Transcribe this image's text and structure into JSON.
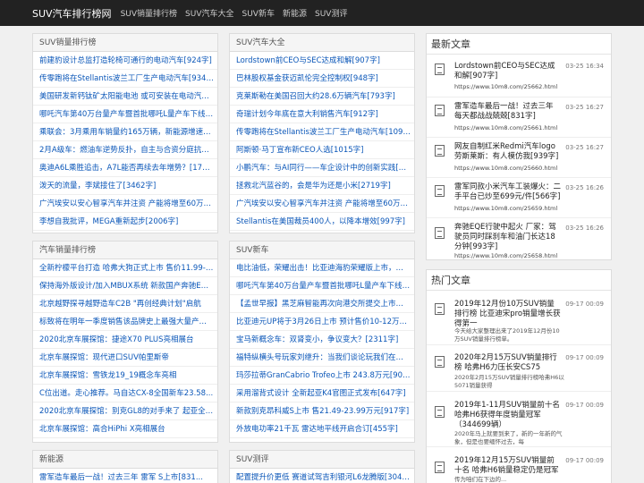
{
  "header": {
    "brand": "SUV汽车排行榜网",
    "nav": [
      "SUV销量排行榜",
      "SUV汽车大全",
      "SUV新车",
      "新能源",
      "SUV测评"
    ]
  },
  "panels": {
    "sales_rank": {
      "title": "SUV销量排行榜",
      "items": [
        "前建豹设计总监打造轮椅可通行的电动汽车[924字]",
        "传零跑将在Stellantis波兰工厂生产电动汽车[934字]",
        "美国研发新钙钛矿太阳能电池 或可安装在电动汽车上",
        "哪吒汽车第40万台量产车暨首批哪吒L量产车下线[8...",
        "乘联会：3月乘用车销量约165万辆，新能源增速37...",
        "2月A级车：燃油车逆势反扑，自主与合资分庭抗礼[...",
        "奥迪A6L乘胜追击，A7L能否再续去年增势？[1788...",
        "泼天的流量，李斌接住了[3462字]",
        "广汽埃安以安心智享汽车并注资 产能将增至60万辆...",
        "李想自我批评，MEGA重新起步[2006字]"
      ]
    },
    "suv_all": {
      "title": "SUV汽车大全",
      "items": [
        "Lordstown前CEO与SEC达成和解[907字]",
        "巴林股权基金获迈凯伦完全控制权[948字]",
        "克莱斯勒在美国召回大约28.6万辆汽车[793字]",
        "奇瑞计划今年底在意大利销售汽车[912字]",
        "传零跑将在Stellantis波兰工厂生产电动汽车[1090...",
        "阿斯顿·马丁宣布新CEO人选[1015字]",
        "小鹏汽车：与AI同行——车企设计中的创新实践[39...",
        "拯救北汽蓝谷的，会是华为还是小米[2719字]",
        "广汽埃安以安心智享汽车并注资 产能将增至60万辆...",
        "Stellantis在美国裁员400人，以降本增效[997字]"
      ]
    },
    "car_rank": {
      "title": "汽车销量排行榜",
      "items": [
        "全新柠檬平台打造 哈弗大狗正式上市 售价11.99-1...",
        "保持海外版设计/加入MBUX系统 新款国产奔驰E级...",
        "北京越野探寻越野造车C2B \"再创经典计划\"启航",
        "标致将在明年一季度销售该品牌史上最强大量产车5...",
        "2020北京车展探馆：捷途X70 PLUS亮相展台",
        "北京车展探馆：现代进口SUV帕里斯帝",
        "北京车展探馆：雪铁龙19_19概念车亮相",
        "C位出道。走心推荐。马自达CX-8全国新车23.58...",
        "2020北京车展探馆：别克GL8的对手来了 起亚全新...",
        "北京车展探馆：高合HiPhi X亮相展台"
      ]
    },
    "suv_new": {
      "title": "SUV新车",
      "items": [
        "电比油低，荣耀出击！比亚迪海豹荣耀版上市，官...",
        "哪吒汽车第40万台量产车暨首批哪吒L量产车下线[9...",
        "【孟世早报】黑芝麻智能再次向港交所提交上市申...",
        "比亚迪元UP将于3月26日上市 预计售价10-12万元[...",
        "宝马新概念车：双肾变小，争议变大？[2311字]",
        "福特纵横头号玩家刘继升：当我们谈论玩我们在谈...",
        "玛莎拉蒂GranCabrio Trofeo上市 243.8万元[901...",
        "采用溜背式设计 全新起亚K4官图正式发布[647字]",
        "新款别克昂科威S上市 售21.49-23.99万元[917字]",
        "外放电功率21千瓦 雷达地平线开启合订[455字]"
      ]
    },
    "new_energy": {
      "title": "新能源",
      "items": [
        "雷军造车最后一战！过去三年 雷军 S上市[831..."
      ]
    },
    "suv_review": {
      "title": "SUV测评",
      "items": [
        "配置提升价更低 赛道试驾吉利银河L6龙腾版[3049字]"
      ]
    }
  },
  "latest": {
    "title": "最新文章",
    "items": [
      {
        "title": "Lordstown前CEO与SEC达成和解[907字]",
        "url": "https://www.10m8.com/25662.html",
        "date": "03-25 16:34"
      },
      {
        "title": "雷军造车最后一战！过去三年 每天都战战兢兢[831字]",
        "url": "https://www.10m8.com/25661.html",
        "date": "03-25 16:27"
      },
      {
        "title": "网友自制红米Redmi汽车logo 劳斯莱斯：有人模仿我[939字]",
        "url": "https://www.10m8.com/25660.html",
        "date": "03-25 16:27"
      },
      {
        "title": "雷军同款小米汽车工装爆火：二手平台已炒至699元/件[566字]",
        "url": "https://www.10m8.com/25659.html",
        "date": "03-25 16:26"
      },
      {
        "title": "奔驰EQE行驶中起火 厂家：驾驶员同时踩刹车和油门长达18分钟[993字]",
        "url": "https://www.10m8.com/25658.html",
        "date": "03-25 16:26"
      }
    ]
  },
  "hot": {
    "title": "热门文章",
    "items": [
      {
        "title": "2019年12月份10万SUV销量排行榜 比亚迪宋pro销量增长获得第一",
        "desc": "今天给大家整理出来了2019年12月份10万SUV销量排行榜单。",
        "date": "09-17 00:09"
      },
      {
        "title": "2020年2月15万SUV销量排行榜 哈弗H6力压长安CS75",
        "desc": "2020年2月15万SUV销量排行榜哈弗H6以5071销量获得",
        "date": "09-17 00:09"
      },
      {
        "title": "2019年1-11月SUV销量前十名 哈弗H6获得年度销量冠军（344699辆）",
        "desc": "2020年马上就要到来了，新的一年新的气象，但是也要缅怀过去，每",
        "date": "09-17 00:09"
      },
      {
        "title": "2019年12月15万SUV销量前十名 哈弗H6销量稳定仍是冠军",
        "desc": "传为咱们在下边的...",
        "date": "09-17 00:09"
      }
    ]
  }
}
